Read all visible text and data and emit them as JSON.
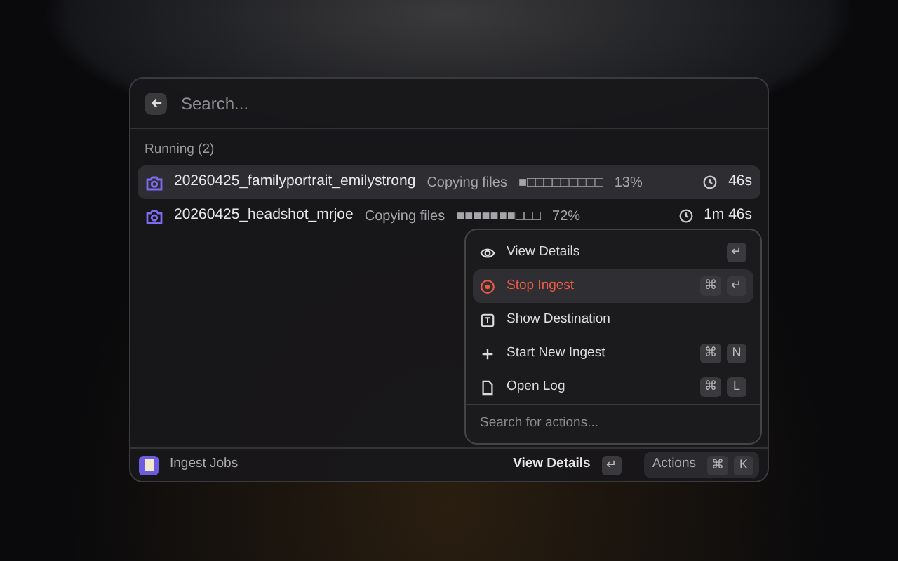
{
  "search": {
    "placeholder": "Search..."
  },
  "section": {
    "label": "Running (2)"
  },
  "jobs": [
    {
      "name": "20260425_familyportrait_emilystrong",
      "status": "Copying files",
      "bar": "■□□□□□□□□□",
      "percent": "13%",
      "elapsed": "46s",
      "selected": true
    },
    {
      "name": "20260425_headshot_mrjoe",
      "status": "Copying files",
      "bar": "■■■■■■■□□□",
      "percent": "72%",
      "elapsed": "1m 46s",
      "selected": false
    }
  ],
  "actions_menu": {
    "items": [
      {
        "kind": "eye",
        "label": "View Details",
        "keys": [
          "↵"
        ],
        "selected": false,
        "danger": false
      },
      {
        "kind": "stop",
        "label": "Stop Ingest",
        "keys": [
          "⌘",
          "↵"
        ],
        "selected": true,
        "danger": true
      },
      {
        "kind": "destination",
        "label": "Show Destination",
        "selected": false,
        "danger": false
      },
      {
        "kind": "plus",
        "label": "Start New Ingest",
        "keys": [
          "⌘",
          "N"
        ],
        "selected": false,
        "danger": false
      },
      {
        "kind": "file",
        "label": "Open Log",
        "keys": [
          "⌘",
          "L"
        ],
        "selected": false,
        "danger": false
      }
    ],
    "search": {
      "placeholder": "Search for actions..."
    }
  },
  "footer": {
    "title": "Ingest Jobs",
    "primary_action": "View Details",
    "primary_keys": [
      "↵"
    ],
    "actions_label": "Actions",
    "actions_keys": [
      "⌘",
      "K"
    ]
  }
}
